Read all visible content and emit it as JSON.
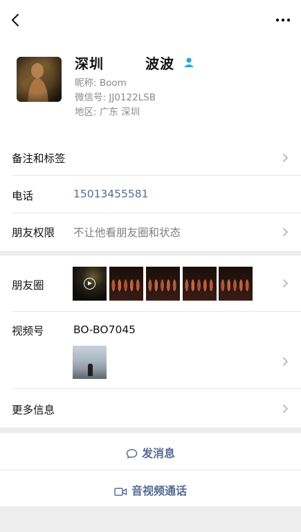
{
  "profile": {
    "name_part1": "深圳",
    "name_part2": "波波",
    "nickname": "昵称: Boom",
    "wechat_id": "微信号: JJ0122LSB",
    "region": "地区: 广东 深圳"
  },
  "rows": {
    "remarks_label": "备注和标签",
    "phone_label": "电话",
    "phone_value": "15013455581",
    "permission_label": "朋友权限",
    "permission_value": "不让他看朋友圈和状态",
    "moments_label": "朋友圈",
    "channels_label": "视频号",
    "channels_value": "BO-BO7045",
    "more_info_label": "更多信息"
  },
  "actions": {
    "message_label": "发消息",
    "call_label": "音视频通话"
  },
  "colors": {
    "link": "#576b95",
    "accent_blue": "#2aa4dc",
    "muted_text": "#8a8a8a",
    "background": "#ededed"
  },
  "icons": {
    "back": "chevron-left-icon",
    "more": "more-dots-icon",
    "verified": "person-icon",
    "chevron": "chevron-right-icon",
    "message": "chat-bubble-icon",
    "call": "video-camera-icon",
    "play": "play-icon"
  }
}
